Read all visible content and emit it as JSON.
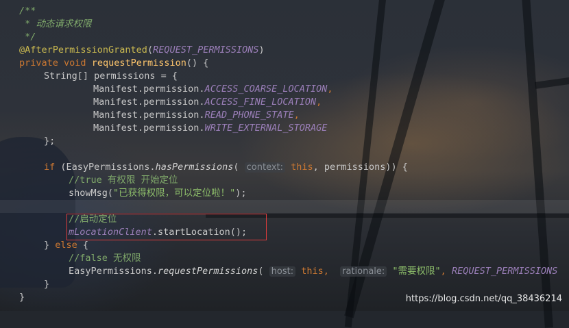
{
  "lines": {
    "l1": "/**",
    "l2": " * 动态请求权限",
    "l3": " */",
    "l4_ann": "@AfterPermissionGranted",
    "l4_open": "(",
    "l4_arg": "REQUEST_PERMISSIONS",
    "l4_close": ")",
    "l5_private": "private",
    "l5_void": "void",
    "l5_name": "requestPermission",
    "l5_rest": "() {",
    "l6": "String[] permissions = {",
    "l7_pre": "Manifest.permission.",
    "l7_const": "ACCESS_COARSE_LOCATION",
    "l7_post": ",",
    "l8_pre": "Manifest.permission.",
    "l8_const": "ACCESS_FINE_LOCATION",
    "l8_post": ",",
    "l9_pre": "Manifest.permission.",
    "l9_const": "READ_PHONE_STATE",
    "l9_post": ",",
    "l10_pre": "Manifest.permission.",
    "l10_const": "WRITE_EXTERNAL_STORAGE",
    "l11": "};",
    "l12_if": "if",
    "l12_a": " (EasyPermissions.",
    "l12_m": "hasPermissions",
    "l12_b": "( ",
    "l12_hint": "context:",
    "l12_this": " this",
    "l12_c": ", permissions)) {",
    "l13": "//true 有权限 开始定位",
    "l14_a": "showMsg(",
    "l14_str": "\"已获得权限，可以定位啦！\"",
    "l14_b": ");",
    "l15": "//启动定位",
    "l16_field": "mLocationClient",
    "l16_rest": ".startLocation();",
    "l17_a": "} ",
    "l17_else": "else",
    "l17_b": " {",
    "l18": "//false 无权限",
    "l19_a": "EasyPermissions.",
    "l19_m": "requestPermissions",
    "l19_b": "( ",
    "l19_hint1": "host:",
    "l19_this": " this",
    "l19_c": ",  ",
    "l19_hint2": "rationale:",
    "l19_str": " \"需要权限\"",
    "l19_d": ", ",
    "l19_const": "REQUEST_PERMISSIONS",
    "l20": "}",
    "l21": "}"
  },
  "watermark": "https://blog.csdn.net/qq_38436214",
  "colors": {
    "comment": "#7fa86a",
    "annotation": "#c9b950",
    "keyword": "#cc7832",
    "method_decl": "#ffc66d",
    "constant": "#9b7fb9",
    "string": "#8dbd6a",
    "highlight_box": "#e03c3c"
  }
}
